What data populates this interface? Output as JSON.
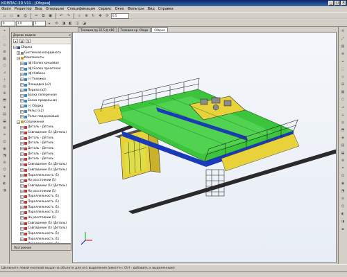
{
  "window": {
    "title": "КОМПАС-3D V11 - [Сборка]",
    "controls": [
      "_",
      "□",
      "×"
    ]
  },
  "menu": [
    "Файл",
    "Редактор",
    "Вид",
    "Операции",
    "Спецификация",
    "Сервис",
    "Окно",
    "Фильтры",
    "Вид",
    "Справка"
  ],
  "toolbar1": {
    "icons": [
      "new-icon",
      "open-icon",
      "save-icon",
      "print-icon",
      "cut-icon",
      "copy-icon",
      "paste-icon",
      "undo-icon",
      "redo-icon",
      "search-icon",
      "zoom-icon",
      "rotate-icon",
      "pan-icon",
      "refresh-icon"
    ],
    "glyphs": [
      "▫",
      "▭",
      "▪",
      "⎙",
      "✂",
      "⧉",
      "▣",
      "↶",
      "↷",
      "⌕",
      "⊕",
      "↻",
      "✥",
      "⟳"
    ],
    "zoom_value": "0.5"
  },
  "toolbar2": {
    "layer_label": "0",
    "scale_value": "1.0",
    "view_value": "1",
    "icons": [
      "select-icon",
      "orient-icon",
      "view-icon",
      "shade-icon",
      "wire-icon",
      "section-icon"
    ],
    "glyphs": [
      "▸",
      "⟲",
      "◨",
      "◧",
      "◫",
      "◪"
    ]
  },
  "tabs": [
    {
      "label": "Тележка пр 32.5 ф 416",
      "active": false
    },
    {
      "label": "Тележка кр. Сборк",
      "active": false
    },
    {
      "label": "Сборка",
      "active": true
    }
  ],
  "tree": {
    "header": "Дерево модели",
    "tools": [
      "▾",
      "▤",
      "⇅"
    ],
    "items": [
      {
        "label": "Сборка",
        "expander": "−",
        "indent": 0,
        "icon": "#2255aa"
      },
      {
        "label": "Системная координата",
        "expander": "+",
        "indent": 1,
        "icon": "#888888"
      },
      {
        "label": "Компоненты",
        "expander": "−",
        "indent": 1,
        "icon": "#d0a020"
      },
      {
        "label": "(ф) Балка концевая",
        "expander": "+",
        "indent": 2,
        "icon": "#3388cc"
      },
      {
        "label": "(ф) Балка пролетная",
        "expander": "+",
        "indent": 2,
        "icon": "#3388cc"
      },
      {
        "label": "(ф) Кабина",
        "expander": "+",
        "indent": 2,
        "icon": "#3388cc"
      },
      {
        "label": "(-) Тележка",
        "expander": "+",
        "indent": 2,
        "icon": "#3388cc"
      },
      {
        "label": "Площадка (х2)",
        "expander": "+",
        "indent": 2,
        "icon": "#3388cc"
      },
      {
        "label": "Перила (х2)",
        "expander": "+",
        "indent": 2,
        "icon": "#3388cc"
      },
      {
        "label": "Балка поперечная",
        "expander": "+",
        "indent": 2,
        "icon": "#3388cc"
      },
      {
        "label": "Балка продольная",
        "expander": "+",
        "indent": 2,
        "icon": "#3388cc"
      },
      {
        "label": "(-) Сборка",
        "expander": "+",
        "indent": 2,
        "icon": "#3388cc"
      },
      {
        "label": "Рельс (х2)",
        "expander": "+",
        "indent": 2,
        "icon": "#3388cc"
      },
      {
        "label": "Рельс подкрановый",
        "expander": "+",
        "indent": 2,
        "icon": "#3388cc"
      },
      {
        "label": "Сопряжения",
        "expander": "−",
        "indent": 1,
        "icon": "#d0a020"
      },
      {
        "label": "Деталь - Деталь",
        "expander": "+",
        "indent": 2,
        "icon": "#cc3333"
      },
      {
        "label": "Совпадение (1) (Деталь)",
        "expander": "+",
        "indent": 2,
        "icon": "#cc3333"
      },
      {
        "label": "Деталь - Деталь",
        "expander": "+",
        "indent": 2,
        "icon": "#cc3333"
      },
      {
        "label": "Деталь - Деталь",
        "expander": "+",
        "indent": 2,
        "icon": "#cc3333"
      },
      {
        "label": "Деталь - Деталь",
        "expander": "+",
        "indent": 2,
        "icon": "#cc3333"
      },
      {
        "label": "Деталь - Деталь",
        "expander": "+",
        "indent": 2,
        "icon": "#cc3333"
      },
      {
        "label": "Деталь - Деталь",
        "expander": "+",
        "indent": 2,
        "icon": "#cc3333"
      },
      {
        "label": "Совпадение (1) (Деталь)",
        "expander": "+",
        "indent": 2,
        "icon": "#cc3333"
      },
      {
        "label": "Совпадение (1) (Деталь)",
        "expander": "+",
        "indent": 2,
        "icon": "#cc3333"
      },
      {
        "label": "Параллельность (1)",
        "expander": "+",
        "indent": 2,
        "icon": "#cc3333"
      },
      {
        "label": "На расстоянии (1)",
        "expander": "+",
        "indent": 2,
        "icon": "#cc3333"
      },
      {
        "label": "Совпадение (1) (Деталь)",
        "expander": "+",
        "indent": 2,
        "icon": "#cc3333"
      },
      {
        "label": "На расстоянии (1)",
        "expander": "+",
        "indent": 2,
        "icon": "#cc3333"
      },
      {
        "label": "Параллельность (1)",
        "expander": "+",
        "indent": 2,
        "icon": "#cc3333"
      },
      {
        "label": "Параллельность (1)",
        "expander": "+",
        "indent": 2,
        "icon": "#cc3333"
      },
      {
        "label": "Параллельность (1)",
        "expander": "+",
        "indent": 2,
        "icon": "#cc3333"
      },
      {
        "label": "Параллельность (1)",
        "expander": "+",
        "indent": 2,
        "icon": "#cc3333"
      },
      {
        "label": "На расстоянии (1)",
        "expander": "+",
        "indent": 2,
        "icon": "#cc3333"
      },
      {
        "label": "Совпадение (1) (Деталь)",
        "expander": "+",
        "indent": 2,
        "icon": "#cc3333"
      },
      {
        "label": "Совпадение (1) (Деталь)",
        "expander": "+",
        "indent": 2,
        "icon": "#cc3333"
      },
      {
        "label": "Параллельность (1)",
        "expander": "+",
        "indent": 2,
        "icon": "#cc3333"
      },
      {
        "label": "Параллельность (1)",
        "expander": "+",
        "indent": 2,
        "icon": "#cc3333"
      },
      {
        "label": "Параллельность (1)",
        "expander": "+",
        "indent": 2,
        "icon": "#cc3333"
      }
    ]
  },
  "tree_bottom_tab": "Построение",
  "left_tools": [
    "⌖",
    "⬚",
    "◇",
    "⊞",
    "▦",
    "⬡",
    "⊿",
    "⟂",
    "◎",
    "⊕",
    "⬒",
    "◈",
    "▤",
    "⬓",
    "⊗",
    "⌗",
    "⊡",
    "◉",
    "⬔",
    "⊘",
    "⌬",
    "⧈",
    "◐",
    "◑"
  ],
  "right_tools": [
    "⟲",
    "⤢",
    "▧",
    "⊕",
    "⌖",
    "⬚",
    "◇",
    "⊞",
    "▦",
    "⬡",
    "⊿",
    "⟂",
    "◎",
    "⬒",
    "◈",
    "▤",
    "⬓",
    "⊗",
    "⌗",
    "⊡",
    "◉",
    "⬔",
    "⊘",
    "⌬",
    "◐",
    "◑",
    "⧈"
  ],
  "status": {
    "message": "Щелкните левой кнопкой мыши на объекте для его выделения (вместе с Ctrl - добавить к выделенным)"
  },
  "colors": {
    "frame": "#d4d0c8",
    "girder_green": "#3cc43c",
    "rail_blue": "#1a3ab8",
    "yellow": "#e8d23a",
    "viewport_bg": "#eef2f7"
  }
}
